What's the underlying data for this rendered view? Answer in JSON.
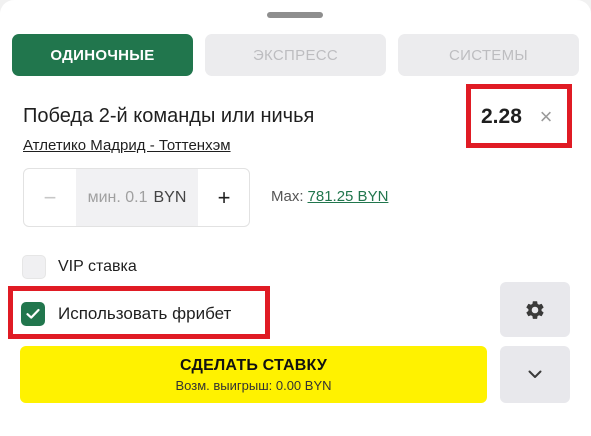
{
  "tabs": [
    {
      "label": "ОДИНОЧНЫЕ",
      "active": true
    },
    {
      "label": "ЭКСПРЕСС",
      "active": false
    },
    {
      "label": "СИСТЕМЫ",
      "active": false
    }
  ],
  "bet": {
    "title": "Победа 2-й команды или ничья",
    "match": "Атлетико Мадрид - Тоттенхэм",
    "odds": "2.28",
    "close_glyph": "×"
  },
  "stake": {
    "minus": "−",
    "placeholder": "мин. 0.1",
    "currency": "BYN",
    "plus": "+",
    "max_label": "Max:",
    "max_value": "781.25 BYN"
  },
  "options": {
    "vip_label": "VIP ставка",
    "vip_checked": false,
    "freebet_label": "Использовать фрибет",
    "freebet_checked": true
  },
  "actions": {
    "make_bet_label": "СДЕЛАТЬ СТАВКУ",
    "possible_win": "Возм. выигрыш: 0.00 BYN",
    "settings_icon": "gear-icon",
    "expand_icon": "chevron-down-icon"
  },
  "colors": {
    "accent_green": "#21764d",
    "highlight_red": "#e01b24",
    "cta_yellow": "#fff200"
  }
}
